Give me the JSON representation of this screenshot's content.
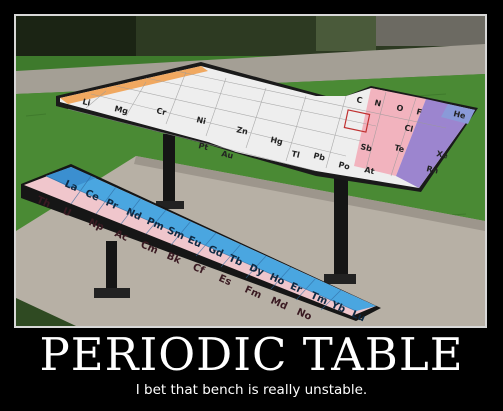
{
  "poster": {
    "title": "PERIODIC TABLE",
    "caption": "I bet that bench is really unstable."
  },
  "photo": {
    "description_colors": {
      "grass": "#3f7a2e",
      "concrete": "#b9b3aa",
      "blue_cells": "#4aa6e0",
      "pink_cells": "#f2b8c2",
      "white_cells": "#f3f3f3",
      "purple_cells": "#9a7fc9",
      "orange_cells": "#f0a45a",
      "metal_legs": "#1c1c1c"
    },
    "bench_symbols": [
      "La",
      "Ce",
      "Pr",
      "Nd",
      "Pm",
      "Sm",
      "Eu",
      "Gd",
      "Tb",
      "Dy",
      "Ho",
      "Er",
      "Tm",
      "Yb",
      "Lu"
    ],
    "bench_lower_symbols": [
      "Th",
      "U",
      "Np",
      "Ac",
      "Cm",
      "Bk",
      "Cf",
      "Es",
      "Fm",
      "Md",
      "No"
    ]
  }
}
